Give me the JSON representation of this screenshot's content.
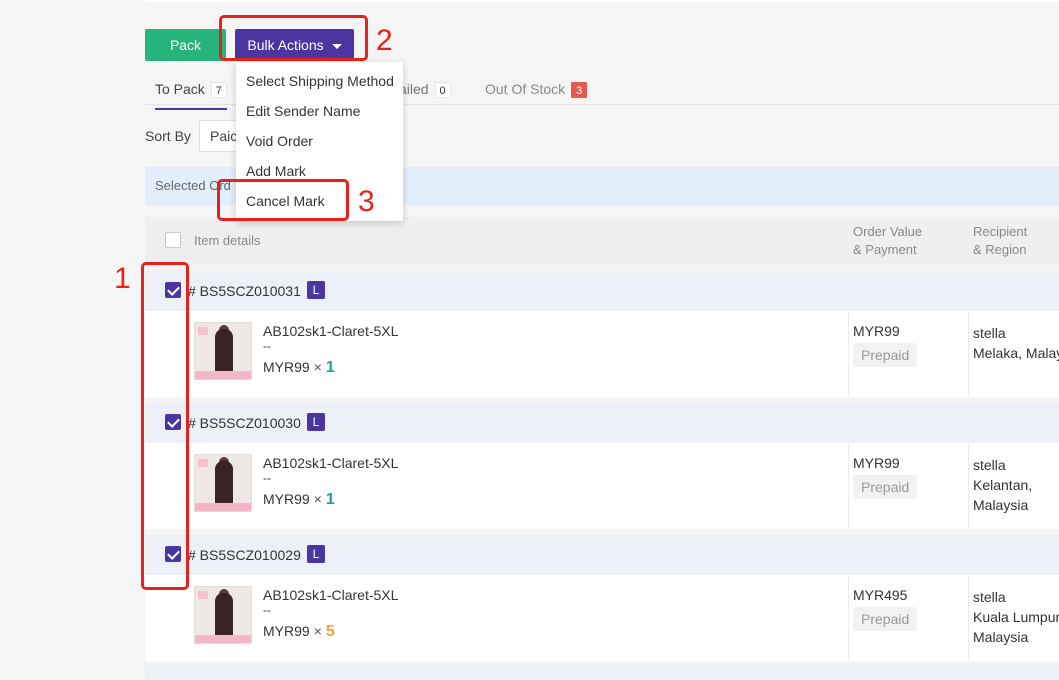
{
  "toolbar": {
    "pack_label": "Pack",
    "bulk_label": "Bulk Actions"
  },
  "tabs": [
    {
      "label": "To Pack",
      "count": "7"
    },
    {
      "label": "ailed",
      "count": "0"
    },
    {
      "label": "Out Of Stock",
      "count": "3"
    }
  ],
  "sort": {
    "label": "Sort By",
    "value": "Paic"
  },
  "selected_bar": {
    "text": "Selected Ord"
  },
  "table_header": {
    "item_details": "Item details",
    "order_value_l1": "Order Value",
    "order_value_l2": "& Payment",
    "recipient_l1": "Recipient",
    "recipient_l2": "& Region"
  },
  "orders": [
    {
      "number": "# BS5SCZ010031",
      "badge": "L",
      "sku": "AB102sk1-Claret-5XL",
      "dash": "--",
      "price": "MYR99",
      "times": "×",
      "qty": "1",
      "order_value": "MYR99",
      "payment": "Prepaid",
      "recipient": "stella",
      "region_l1": "Melaka, Malay",
      "region_l2": ""
    },
    {
      "number": "# BS5SCZ010030",
      "badge": "L",
      "sku": "AB102sk1-Claret-5XL",
      "dash": "--",
      "price": "MYR99",
      "times": "×",
      "qty": "1",
      "order_value": "MYR99",
      "payment": "Prepaid",
      "recipient": "stella",
      "region_l1": "Kelantan,",
      "region_l2": "Malaysia"
    },
    {
      "number": "# BS5SCZ010029",
      "badge": "L",
      "sku": "AB102sk1-Claret-5XL",
      "dash": "--",
      "price": "MYR99",
      "times": "×",
      "qty": "5",
      "order_value": "MYR495",
      "payment": "Prepaid",
      "recipient": "stella",
      "region_l1": "Kuala Lumpur",
      "region_l2": "Malaysia"
    }
  ],
  "dropdown": {
    "items": [
      "Select Shipping Method",
      "Edit Sender Name",
      "Void Order",
      "Add Mark",
      "Cancel Mark"
    ]
  },
  "annotations": {
    "n1": "1",
    "n2": "2",
    "n3": "3"
  },
  "colors": {
    "primary": "#4b35a0",
    "pack_green": "#26b37c",
    "annotation_red": "#e8221b",
    "qty_teal": "#1aa59a",
    "qty_orange": "#f0a03c",
    "oos_badge": "#e55a4e"
  }
}
